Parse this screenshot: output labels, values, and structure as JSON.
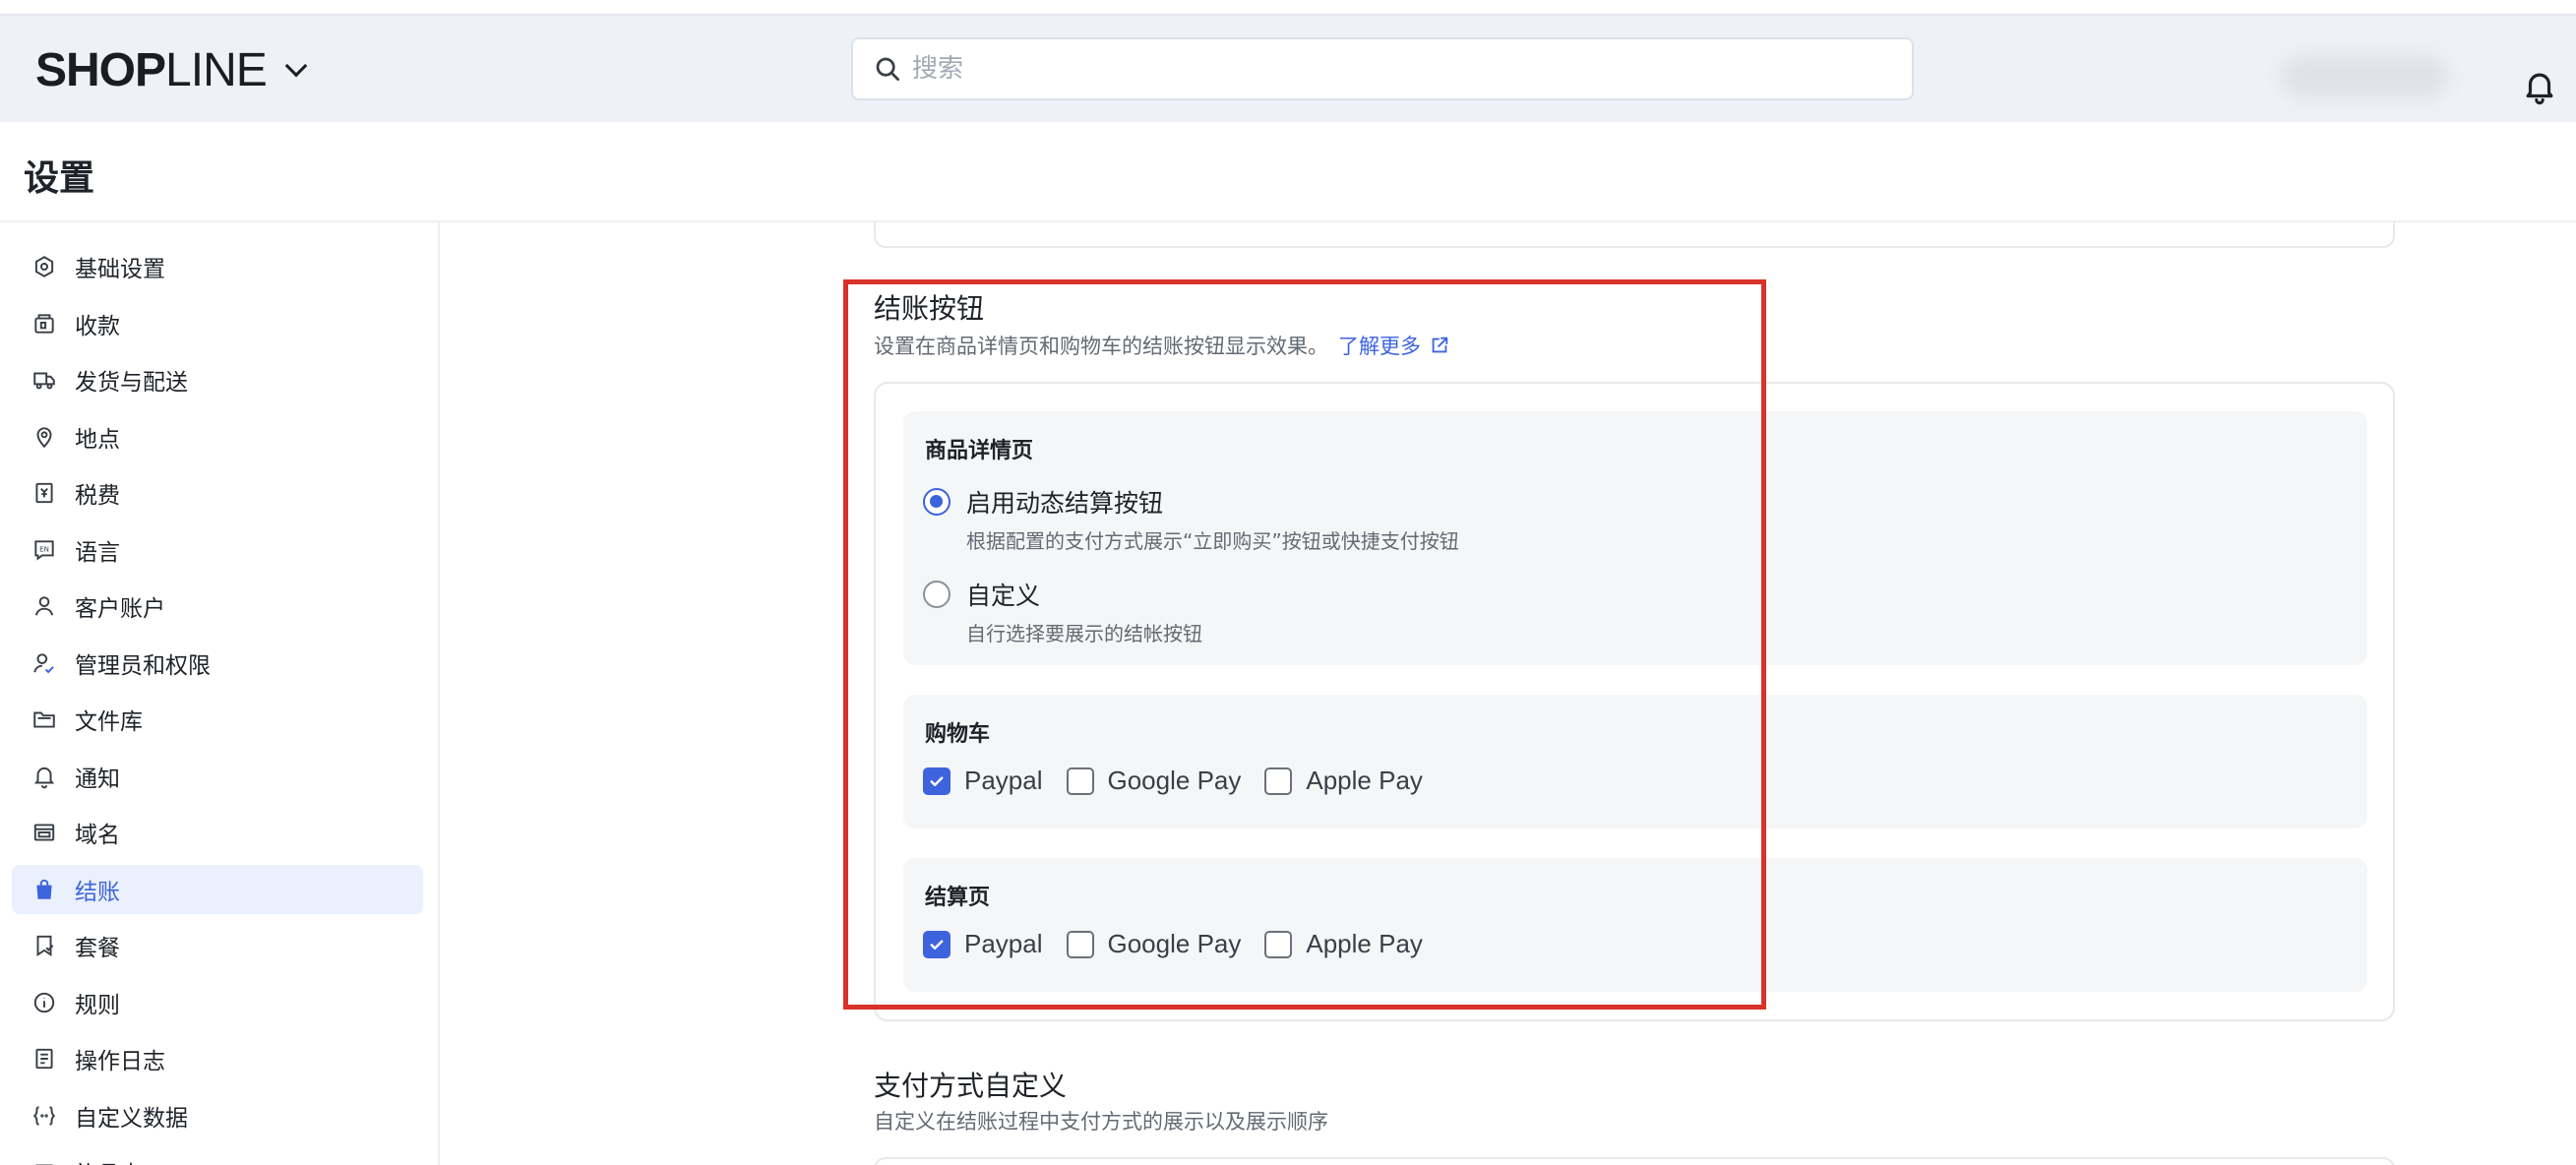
{
  "header": {
    "logo_bold": "SHOP",
    "logo_light": "LINE",
    "search_placeholder": "搜索"
  },
  "page": {
    "title": "设置"
  },
  "sidebar": {
    "items": [
      {
        "label": "基础设置",
        "icon": "hexagon-settings-icon"
      },
      {
        "label": "收款",
        "icon": "wallet-icon"
      },
      {
        "label": "发货与配送",
        "icon": "truck-icon"
      },
      {
        "label": "地点",
        "icon": "location-pin-icon"
      },
      {
        "label": "税费",
        "icon": "receipt-icon"
      },
      {
        "label": "语言",
        "icon": "language-icon"
      },
      {
        "label": "客户账户",
        "icon": "user-icon"
      },
      {
        "label": "管理员和权限",
        "icon": "user-check-icon"
      },
      {
        "label": "文件库",
        "icon": "folder-icon"
      },
      {
        "label": "通知",
        "icon": "bell-icon"
      },
      {
        "label": "域名",
        "icon": "domain-icon"
      },
      {
        "label": "结账",
        "icon": "shopping-bag-icon",
        "active": true
      },
      {
        "label": "套餐",
        "icon": "bookmark-icon"
      },
      {
        "label": "规则",
        "icon": "info-icon"
      },
      {
        "label": "操作日志",
        "icon": "log-icon"
      },
      {
        "label": "自定义数据",
        "icon": "custom-data-icon"
      },
      {
        "label": "礼品卡",
        "icon": "gift-card-icon"
      }
    ]
  },
  "checkout_buttons": {
    "title": "结账按钮",
    "description": "设置在商品详情页和购物车的结账按钮显示效果。",
    "learn_more": "了解更多",
    "product_page": {
      "title": "商品详情页",
      "options": [
        {
          "label": "启用动态结算按钮",
          "hint": "根据配置的支付方式展示“立即购买”按钮或快捷支付按钮",
          "selected": true
        },
        {
          "label": "自定义",
          "hint": "自行选择要展示的结帐按钮",
          "selected": false
        }
      ]
    },
    "cart": {
      "title": "购物车",
      "options": [
        {
          "label": "Paypal",
          "checked": true
        },
        {
          "label": "Google Pay",
          "checked": false
        },
        {
          "label": "Apple Pay",
          "checked": false
        }
      ]
    },
    "checkout_page": {
      "title": "结算页",
      "options": [
        {
          "label": "Paypal",
          "checked": true
        },
        {
          "label": "Google Pay",
          "checked": false
        },
        {
          "label": "Apple Pay",
          "checked": false
        }
      ]
    }
  },
  "payment_customization": {
    "title": "支付方式自定义",
    "description": "自定义在结账过程中支付方式的展示以及展示顺序"
  },
  "colors": {
    "accent": "#3d63dd",
    "highlight_border": "#d8322a",
    "active_bg": "#eaf0fd"
  }
}
